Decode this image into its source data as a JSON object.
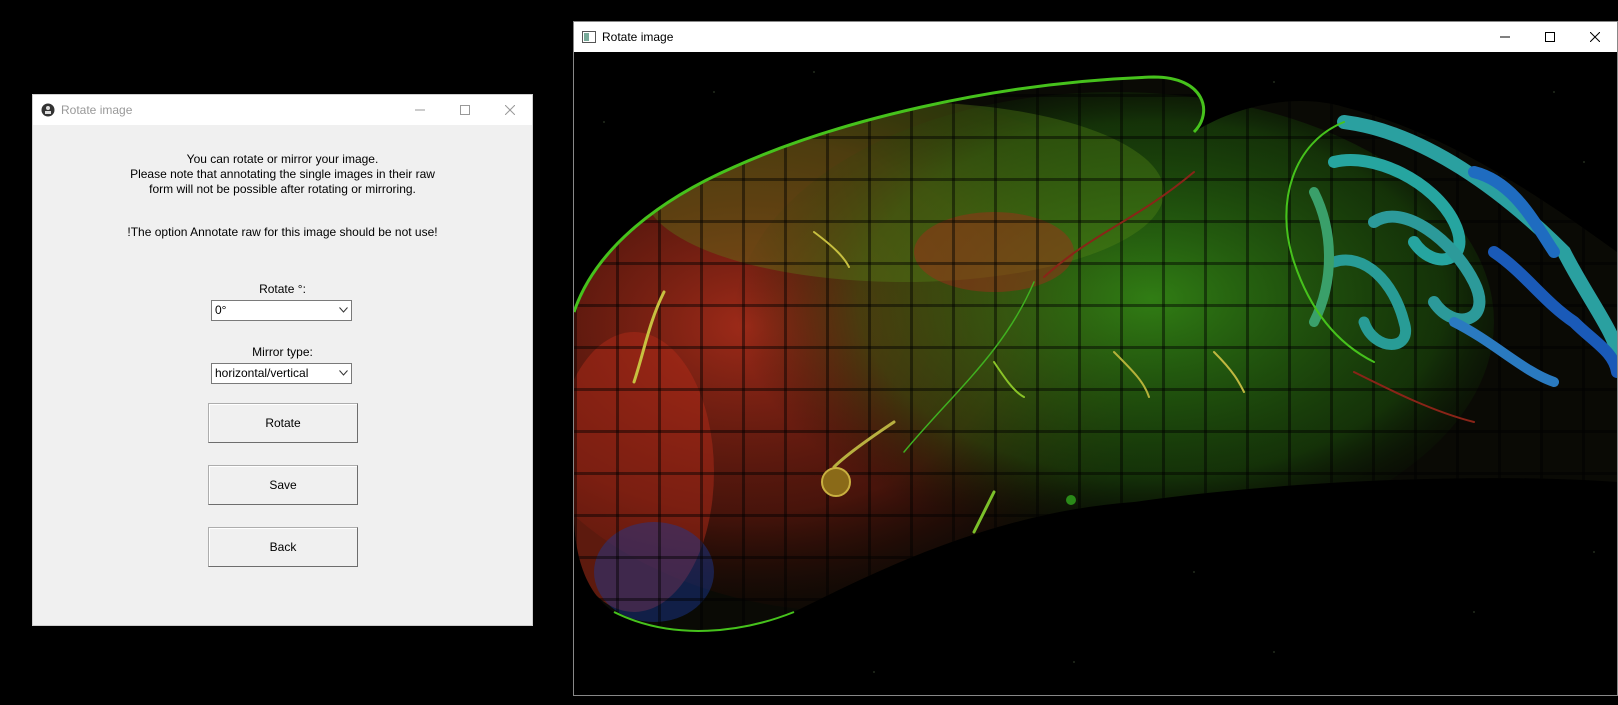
{
  "dialog": {
    "title": "Rotate image",
    "info_line1": "You can rotate or mirror your image.",
    "info_line2": "Please note that annotating the single images in their raw",
    "info_line3": "form will not be possible after rotating or mirroring.",
    "warning": "!The option Annotate raw for this image should be not use!",
    "rotate_label": "Rotate °:",
    "rotate_value": "0°",
    "mirror_label": "Mirror type:",
    "mirror_value": "horizontal/vertical",
    "rotate_button": "Rotate",
    "save_button": "Save",
    "back_button": "Back"
  },
  "image_window": {
    "title": "Rotate image"
  },
  "colors": {
    "red_channel": "#c0281a",
    "green_channel": "#3cc21c",
    "blue_channel": "#1b5fbf",
    "cyan_channel": "#1aa0a0"
  }
}
